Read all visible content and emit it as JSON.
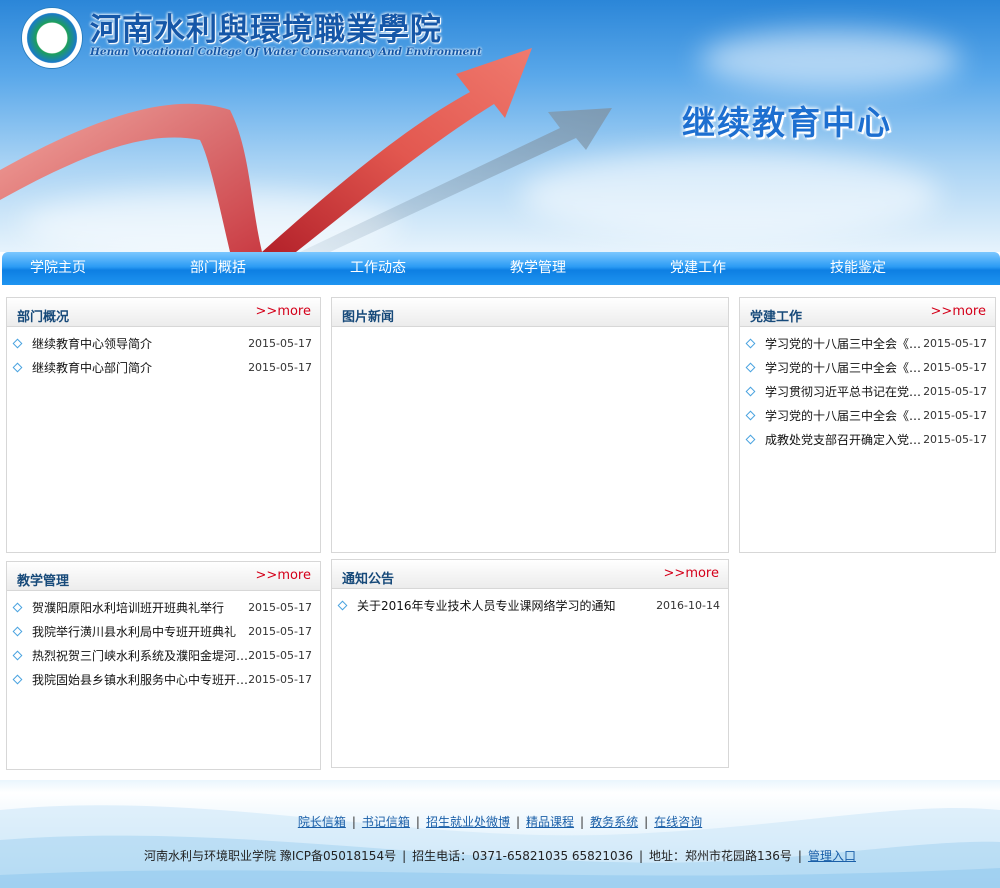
{
  "header": {
    "college_name": "河南水利與環境職業學院",
    "college_name_en": "Henan Vocational College Of Water Conservancy And Environment",
    "site_title": "继续教育中心"
  },
  "nav": {
    "items": [
      "学院主页",
      "部门概括",
      "工作动态",
      "教学管理",
      "党建工作",
      "技能鉴定"
    ]
  },
  "sections": {
    "department": {
      "title": "部门概况",
      "more": ">>more",
      "items": [
        {
          "text": "继续教育中心领导简介",
          "date": "2015-05-17"
        },
        {
          "text": "继续教育中心部门简介",
          "date": "2015-05-17"
        }
      ]
    },
    "photo_news": {
      "title": "图片新闻"
    },
    "party": {
      "title": "党建工作",
      "more": ">>more",
      "items": [
        {
          "text": "学习党的十八届三中全会《…",
          "date": "2015-05-17"
        },
        {
          "text": "学习党的十八届三中全会《…",
          "date": "2015-05-17"
        },
        {
          "text": "学习贯彻习近平总书记在党…",
          "date": "2015-05-17"
        },
        {
          "text": "学习党的十八届三中全会《…",
          "date": "2015-05-17"
        },
        {
          "text": "成教处党支部召开确定入党…",
          "date": "2015-05-17"
        }
      ]
    },
    "teaching": {
      "title": "教学管理",
      "more": ">>more",
      "items": [
        {
          "text": "贺濮阳原阳水利培训班开班典礼举行",
          "date": "2015-05-17"
        },
        {
          "text": "我院举行潢川县水利局中专班开班典礼",
          "date": "2015-05-17"
        },
        {
          "text": "热烈祝贺三门峡水利系统及濮阳金堤河…",
          "date": "2015-05-17"
        },
        {
          "text": "我院固始县乡镇水利服务中心中专班开…",
          "date": "2015-05-17"
        }
      ]
    },
    "notice": {
      "title": "通知公告",
      "more": ">>more",
      "items": [
        {
          "text": "关于2016年专业技术人员专业课网络学习的通知",
          "date": "2016-10-14"
        }
      ]
    }
  },
  "footer": {
    "links": [
      "院长信箱",
      "书记信箱",
      "招生就业处微博",
      "精品课程",
      "教务系统",
      "在线咨询"
    ],
    "school": "河南水利与环境职业学院",
    "icp": "豫ICP备05018154号",
    "phone": "招生电话：0371-65821035 65821036",
    "address": "地址：郑州市花园路136号",
    "admin": "管理入口"
  }
}
